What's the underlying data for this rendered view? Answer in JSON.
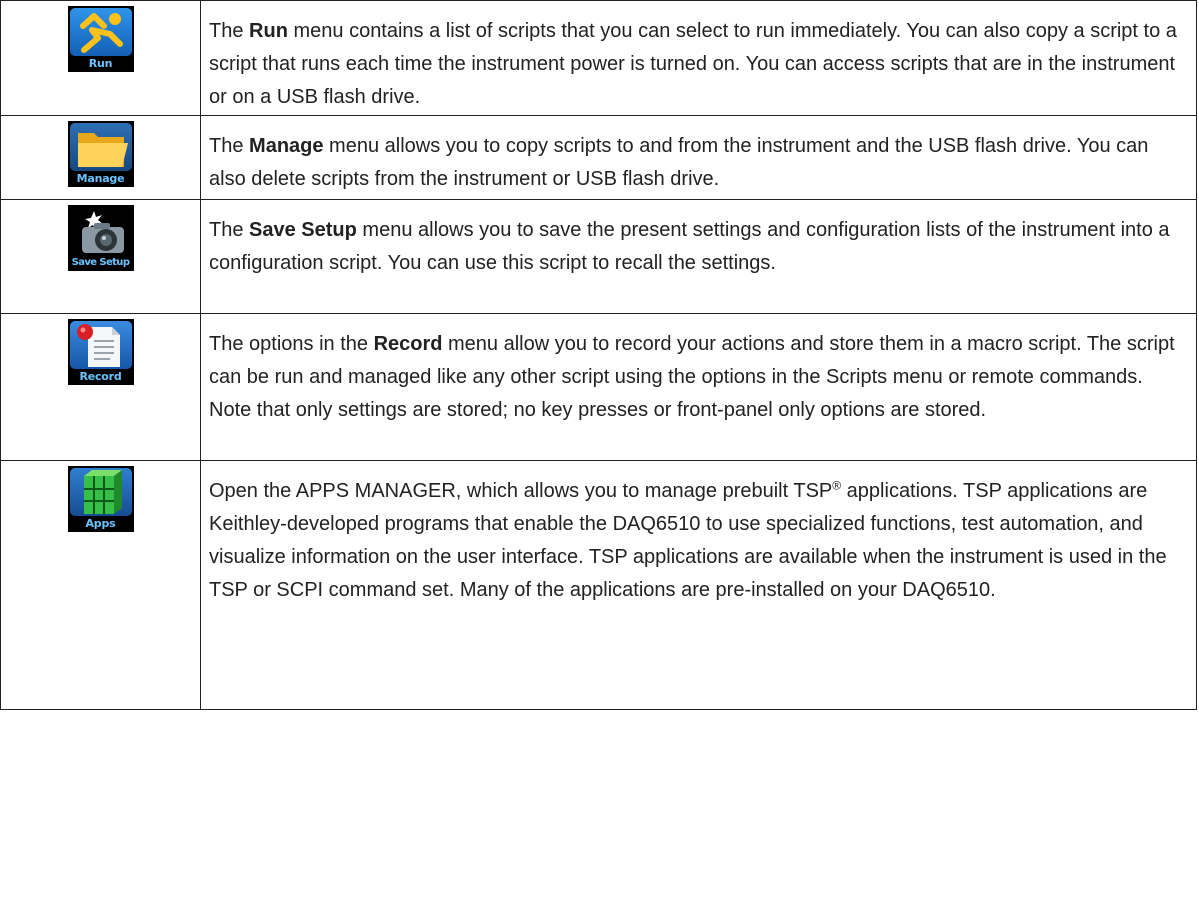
{
  "rows": [
    {
      "icon": {
        "name": "run-icon",
        "caption": "Run",
        "color": "#1a7fd6"
      },
      "text": {
        "before": "The ",
        "bold": "Run",
        "after": " menu contains a list of scripts that you can select to run immediately. You can also copy a script to a script that runs each time the instrument power is turned on. You can access scripts that are in the instrument or on a USB flash drive."
      }
    },
    {
      "icon": {
        "name": "manage-icon",
        "caption": "Manage",
        "color": "#f5c54a"
      },
      "text": {
        "before": "The ",
        "bold": "Manage",
        "after": " menu allows you to copy scripts to and from the instrument and the USB flash drive. You can also delete scripts from the instrument or USB flash drive."
      }
    },
    {
      "icon": {
        "name": "save-setup-icon",
        "caption": "Save Setup",
        "color": "#5a6b78"
      },
      "text": {
        "before": "The ",
        "bold": "Save Setup",
        "after": " menu allows you to save the present settings and configuration lists of the instrument into a configuration script. You can use this script to recall the settings."
      }
    },
    {
      "icon": {
        "name": "record-icon",
        "caption": "Record",
        "color": "#1e6fc6"
      },
      "text": {
        "before": "The options in the ",
        "bold": "Record",
        "after": " menu allow you to record your actions and store them in a macro script. The script can be run and managed like any other script using the options in the Scripts menu or remote commands. Note that only settings are stored; no key presses or front-panel only options are stored."
      }
    },
    {
      "icon": {
        "name": "apps-icon",
        "caption": "Apps",
        "color": "#2fb34a"
      },
      "text": {
        "before": "Open the APPS MANAGER, which allows you to manage prebuilt TSP",
        "sup": "®",
        "after": " applications. TSP applications are Keithley-developed programs that enable the DAQ6510 to use specialized functions, test automation, and visualize information on the user interface. TSP applications are available when the instrument is used in the TSP or SCPI command set. Many of the applications are pre-installed on your DAQ6510."
      }
    }
  ]
}
